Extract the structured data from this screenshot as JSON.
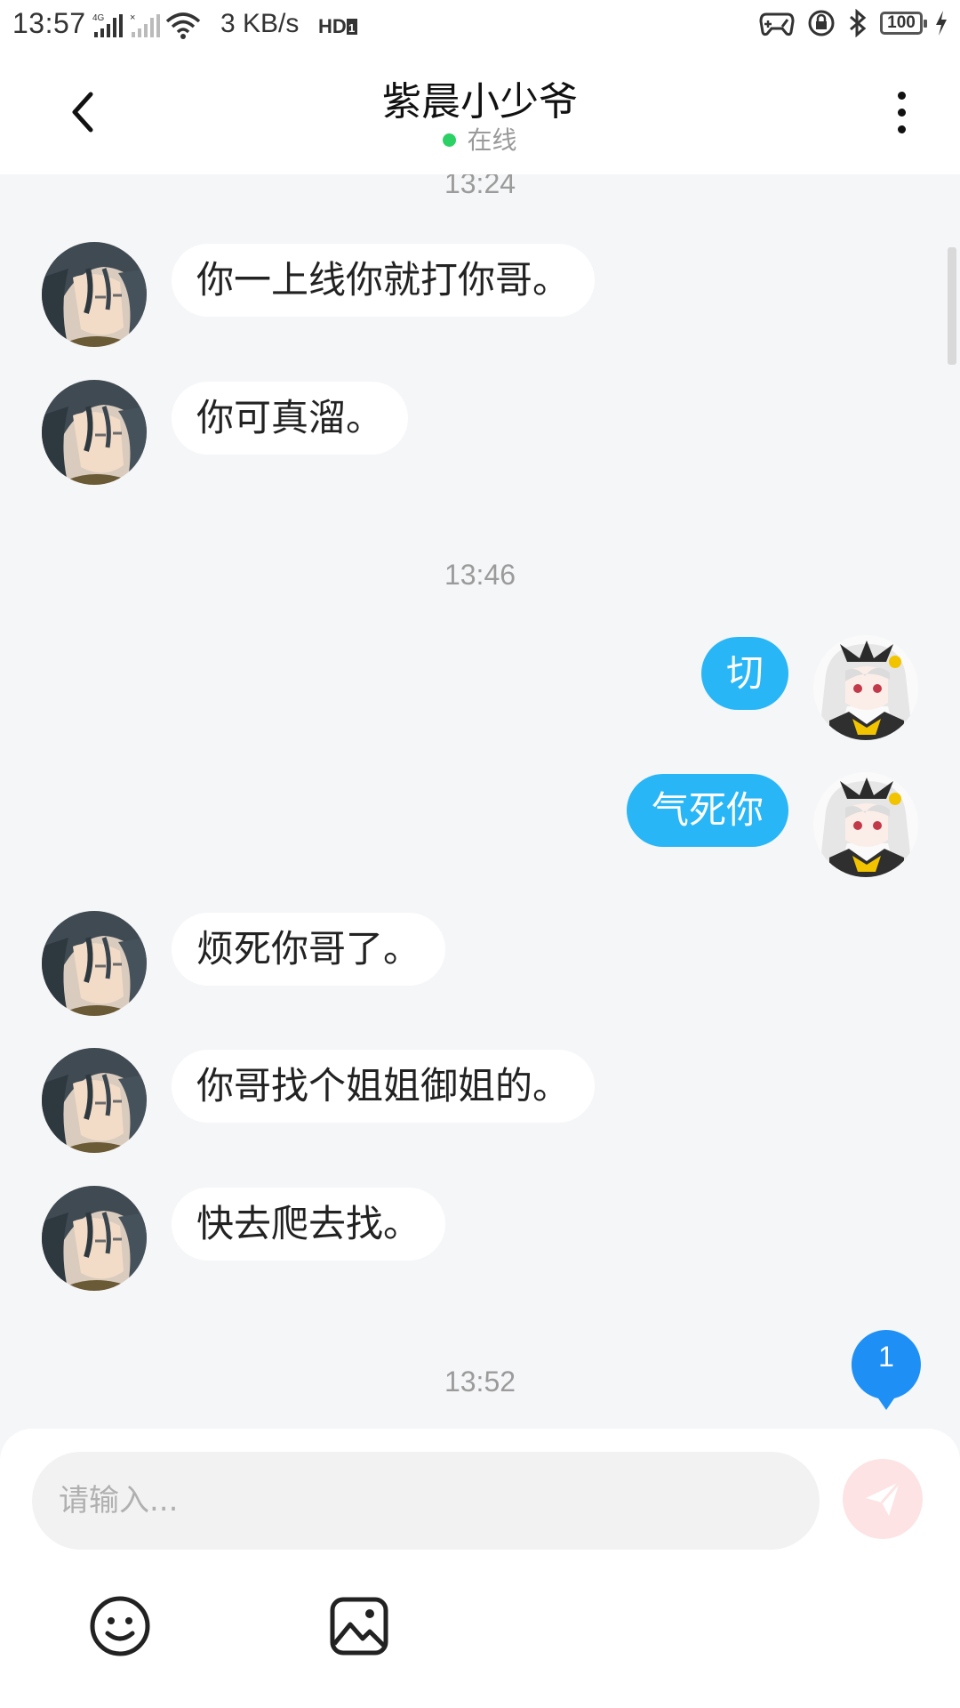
{
  "status_bar": {
    "time": "13:57",
    "network_speed": "3 KB/s",
    "battery": "100"
  },
  "header": {
    "title": "紫晨小少爷",
    "status": "在线"
  },
  "messages": {
    "timestamps": [
      "13:24",
      "13:46",
      "13:52"
    ],
    "items": [
      {
        "side": "in",
        "text": "你一上线你就打你哥。"
      },
      {
        "side": "in",
        "text": "你可真溜。"
      },
      {
        "side": "out",
        "text": "切"
      },
      {
        "side": "out",
        "text": "气死你"
      },
      {
        "side": "in",
        "text": "烦死你哥了。"
      },
      {
        "side": "in",
        "text": "你哥找个姐姐御姐的。"
      },
      {
        "side": "in",
        "text": "快去爬去找。"
      }
    ],
    "unread_count": "1"
  },
  "composer": {
    "placeholder": "请输入...",
    "send_icon": "send-icon",
    "emoji_icon": "emoji-icon",
    "image_icon": "image-icon"
  },
  "colors": {
    "accent": "#29b6f6",
    "online": "#2bd164",
    "send_disabled": "#fde3e3"
  }
}
